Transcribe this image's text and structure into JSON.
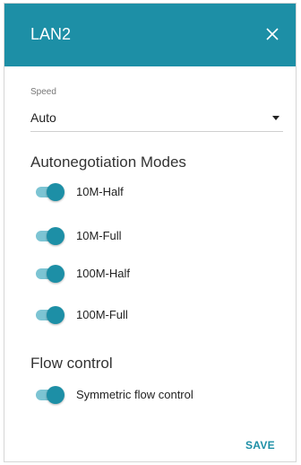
{
  "dialog": {
    "title": "LAN2",
    "close_icon": "close-icon",
    "header_color": "#1d8fa6"
  },
  "speed": {
    "label": "Speed",
    "value": "Auto"
  },
  "autoneg": {
    "title": "Autonegotiation Modes",
    "modes": [
      {
        "label": "10M-Half",
        "enabled": true
      },
      {
        "label": "10M-Full",
        "enabled": true
      },
      {
        "label": "100M-Half",
        "enabled": true
      },
      {
        "label": "100M-Full",
        "enabled": true
      }
    ]
  },
  "flow": {
    "title": "Flow control",
    "symmetric": {
      "label": "Symmetric flow control",
      "enabled": true
    }
  },
  "actions": {
    "save_label": "SAVE"
  }
}
